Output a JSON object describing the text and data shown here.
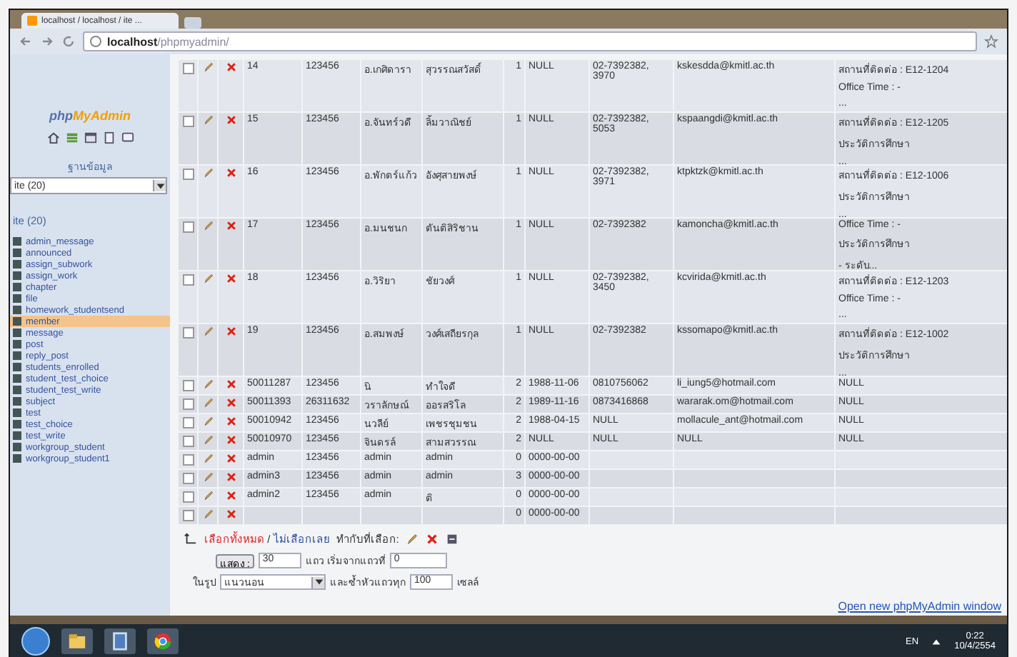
{
  "browser": {
    "tab_title": "localhost / localhost / ite ...",
    "address_host": "localhost",
    "address_path": "/phpmyadmin/"
  },
  "sidebar": {
    "logo_php": "php",
    "logo_name": "MyAdmin",
    "database_label": "ฐานข้อมูล",
    "database_select": "ite (20)",
    "database_title": "ite (20)",
    "tables": [
      {
        "label": "admin_message",
        "selected": false
      },
      {
        "label": "announced",
        "selected": false
      },
      {
        "label": "assign_subwork",
        "selected": false
      },
      {
        "label": "assign_work",
        "selected": false
      },
      {
        "label": "chapter",
        "selected": false
      },
      {
        "label": "file",
        "selected": false
      },
      {
        "label": "homework_studentsend",
        "selected": false
      },
      {
        "label": "member",
        "selected": true
      },
      {
        "label": "message",
        "selected": false
      },
      {
        "label": "post",
        "selected": false
      },
      {
        "label": "reply_post",
        "selected": false
      },
      {
        "label": "students_enrolled",
        "selected": false
      },
      {
        "label": "student_test_choice",
        "selected": false
      },
      {
        "label": "student_test_write",
        "selected": false
      },
      {
        "label": "subject",
        "selected": false
      },
      {
        "label": "test",
        "selected": false
      },
      {
        "label": "test_choice",
        "selected": false
      },
      {
        "label": "test_write",
        "selected": false
      },
      {
        "label": "workgroup_student",
        "selected": false
      },
      {
        "label": "workgroup_student1",
        "selected": false
      }
    ]
  },
  "table": {
    "rows": [
      {
        "kind": "tall",
        "checked": false,
        "cells": [
          "14",
          "123456",
          "อ.เกศิดารา",
          "สุวรรณสวัสดิ์",
          "1",
          "NULL",
          "02-7392382, 3970",
          "kskesdda@kmitl.ac.th"
        ],
        "info": [
          "สถานที่ติดต่อ : E12-1204",
          "Office Time : -",
          "..."
        ]
      },
      {
        "kind": "tall",
        "checked": false,
        "cells": [
          "15",
          "123456",
          "อ.จันทร์วดี",
          "ลิ้มวาณิชย์",
          "1",
          "NULL",
          "02-7392382, 5053",
          "kspaangdi@kmitl.ac.th"
        ],
        "info": [
          "สถานที่ติดต่อ : E12-1205",
          "ประวัติการศึกษา",
          "..."
        ]
      },
      {
        "kind": "tall",
        "checked": false,
        "cells": [
          "16",
          "123456",
          "อ.พักตร์แก้ว",
          "อังศุสายพงษ์",
          "1",
          "NULL",
          "02-7392382, 3971",
          "ktpktzk@kmitl.ac.th"
        ],
        "info": [
          "สถานที่ติดต่อ : E12-1006",
          "ประวัติการศึกษา",
          "..."
        ]
      },
      {
        "kind": "tall",
        "checked": false,
        "cells": [
          "17",
          "123456",
          "อ.มนชนก",
          "ตันติสิริชาน",
          "1",
          "NULL",
          "02-7392382",
          "kamoncha@kmitl.ac.th"
        ],
        "info": [
          "Office Time : -",
          "ประวัติการศึกษา",
          "- ระดับ..."
        ]
      },
      {
        "kind": "tall",
        "checked": false,
        "cells": [
          "18",
          "123456",
          "อ.วิริยา",
          "ชัยวงศ์",
          "1",
          "NULL",
          "02-7392382, 3450",
          "kcvirida@kmitl.ac.th"
        ],
        "info": [
          "สถานที่ติดต่อ : E12-1203",
          "Office Time : -",
          "..."
        ]
      },
      {
        "kind": "tall",
        "checked": false,
        "cells": [
          "19",
          "123456",
          "อ.สมพงษ์",
          "วงศ์เสถียรกุล",
          "1",
          "NULL",
          "02-7392382",
          "kssomapo@kmitl.ac.th"
        ],
        "info": [
          "สถานที่ติดต่อ : E12-1002",
          "ประวัติการศึกษา",
          "..."
        ]
      },
      {
        "kind": "short",
        "checked": false,
        "cells": [
          "50011287",
          "123456",
          "นิ",
          "ทำใจดี",
          "2",
          "1988-11-06",
          "0810756062",
          "li_iung5@hotmail.com"
        ],
        "info": [
          "NULL"
        ]
      },
      {
        "kind": "short",
        "checked": false,
        "cells": [
          "50011393",
          "26311632",
          "วราลักษณ์",
          "ออรสริโล",
          "2",
          "1989-11-16",
          "0873416868",
          "wararak.om@hotmail.com"
        ],
        "info": [
          "NULL"
        ]
      },
      {
        "kind": "short",
        "checked": false,
        "cells": [
          "50010942",
          "123456",
          "นวลีย์",
          "เพชรชุมชน",
          "2",
          "1988-04-15",
          "NULL",
          "mollacule_ant@hotmail.com"
        ],
        "info": [
          "NULL"
        ]
      },
      {
        "kind": "short",
        "checked": false,
        "cells": [
          "50010970",
          "123456",
          "จินดรล์",
          "สามสวรรณ",
          "2",
          "NULL",
          "NULL",
          "NULL"
        ],
        "info": [
          "NULL"
        ]
      },
      {
        "kind": "short",
        "checked": false,
        "cells": [
          "admin",
          "123456",
          "admin",
          "admin",
          "0",
          "0000-00-00",
          "",
          ""
        ]
      },
      {
        "kind": "short",
        "checked": false,
        "cells": [
          "admin3",
          "123456",
          "admin",
          "admin",
          "3",
          "0000-00-00",
          "",
          ""
        ]
      },
      {
        "kind": "short",
        "checked": false,
        "cells": [
          "admin2",
          "123456",
          "admin",
          "ติ",
          "0",
          "0000-00-00",
          "",
          ""
        ]
      },
      {
        "kind": "short",
        "checked": false,
        "cells": [
          "",
          "",
          "",
          "",
          "0",
          "0000-00-00",
          "",
          ""
        ]
      }
    ]
  },
  "actions": {
    "select_all": "เลือกทั้งหมด",
    "separator": "/",
    "select_none": "ไม่เลือกเลย",
    "with_selected": "ทำกับที่เลือก:"
  },
  "paging": {
    "show_button": "แสดง :",
    "rows": "30",
    "start_label": "แถว เริ่มจากแถวที่",
    "start": "0",
    "mode_label": "ในรูป",
    "mode": "แนวนอน",
    "repeat_label": "และซ้ำหัวแถวทุก",
    "repeat": "100",
    "repeat_unit": "เซลล์"
  },
  "footer_link": "Open new phpMyAdmin window",
  "taskbar": {
    "language": "EN",
    "time": "0:22",
    "date": "10/4/2554"
  }
}
